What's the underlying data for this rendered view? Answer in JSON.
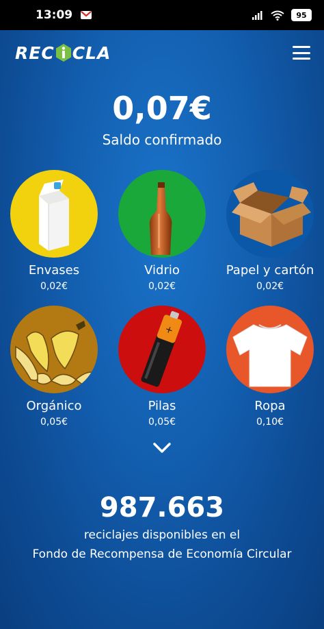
{
  "status_bar": {
    "time": "13:09",
    "notification_icon": "gmail-icon",
    "signal_icon": "signal-icon",
    "wifi_icon": "wifi-icon",
    "battery": "95"
  },
  "header": {
    "logo_text_left": "REC",
    "logo_text_right": "CLA",
    "logo_center_glyph": "i",
    "logo_color": "#ffffff",
    "logo_accent": "#7ac143",
    "menu_icon": "menu-icon"
  },
  "balance": {
    "amount": "0,07€",
    "label": "Saldo confirmado"
  },
  "categories": [
    {
      "name": "Envases",
      "value": "0,02€",
      "color": "#f2d10f",
      "icon": "carton-icon"
    },
    {
      "name": "Vidrio",
      "value": "0,02€",
      "color": "#1ba83b",
      "icon": "bottle-icon"
    },
    {
      "name": "Papel y cartón",
      "value": "0,02€",
      "color": "#0b58a8",
      "icon": "box-icon"
    },
    {
      "name": "Orgánico",
      "value": "0,05€",
      "color": "#b37a14",
      "icon": "banana-icon"
    },
    {
      "name": "Pilas",
      "value": "0,05€",
      "color": "#cc0e0e",
      "icon": "battery-icon"
    },
    {
      "name": "Ropa",
      "value": "0,10€",
      "color": "#e8572a",
      "icon": "tshirt-icon"
    }
  ],
  "expand_icon": "chevron-down-icon",
  "fund": {
    "count": "987.663",
    "line1": "reciclajes disponibles en el",
    "line2": "Fondo de Recompensa de Economía Circular"
  }
}
